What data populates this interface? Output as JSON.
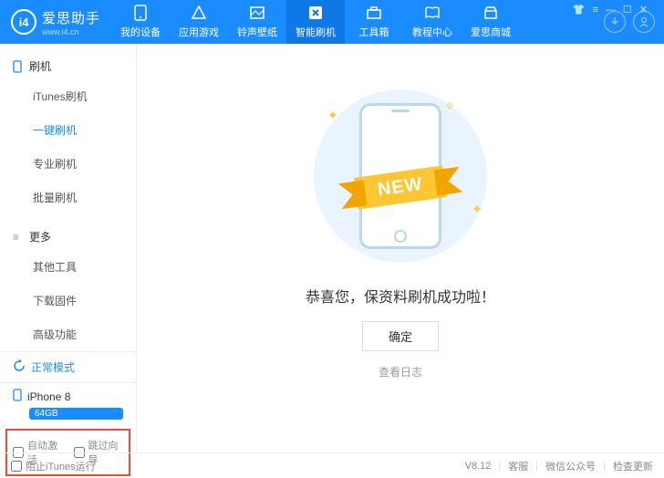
{
  "logo": {
    "badge": "i4",
    "title": "爱思助手",
    "sub": "www.i4.cn"
  },
  "nav": [
    {
      "label": "我的设备"
    },
    {
      "label": "应用游戏"
    },
    {
      "label": "铃声壁纸"
    },
    {
      "label": "智能刷机",
      "active": true
    },
    {
      "label": "工具箱"
    },
    {
      "label": "教程中心"
    },
    {
      "label": "爱思商城"
    }
  ],
  "sidebar": {
    "section1": {
      "title": "刷机",
      "items": [
        "iTunes刷机",
        "一键刷机",
        "专业刷机",
        "批量刷机"
      ],
      "activeIndex": 1
    },
    "section2": {
      "title": "更多",
      "items": [
        "其他工具",
        "下载固件",
        "高级功能"
      ]
    },
    "status": "正常模式",
    "device": {
      "name": "iPhone 8",
      "storage": "64GB"
    },
    "checks": {
      "autoActivate": "自动激活",
      "skipWizard": "跳过向导"
    }
  },
  "main": {
    "ribbon": "NEW",
    "success": "恭喜您，保资料刷机成功啦！",
    "ok": "确定",
    "viewLog": "查看日志"
  },
  "footer": {
    "blockItunes": "阻止iTunes运行",
    "version": "V8.12",
    "links": [
      "客服",
      "微信公众号",
      "检查更新"
    ]
  }
}
